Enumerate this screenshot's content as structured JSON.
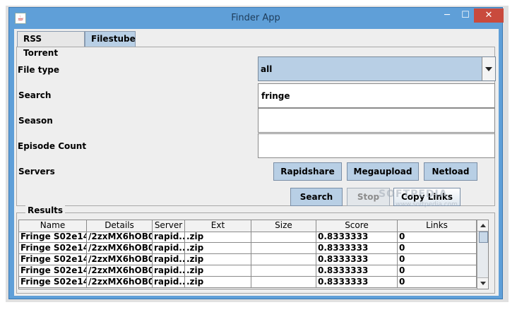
{
  "window": {
    "title": "Finder App",
    "min_glyph": "─",
    "max_glyph": "☐",
    "close_glyph": "✕",
    "app_icon_glyph": "☕"
  },
  "tabs": [
    {
      "label": "RSS Torrent"
    },
    {
      "label": "Filestube"
    }
  ],
  "form": {
    "file_type_label": "File type",
    "file_type_value": "all",
    "search_label": "Search",
    "search_value": "fringe",
    "season_label": "Season",
    "season_value": "",
    "episode_count_label": "Episode Count",
    "episode_count_value": "",
    "servers_label": "Servers"
  },
  "servers": {
    "rapidshare": "Rapidshare",
    "megaupload": "Megaupload",
    "netload": "Netload"
  },
  "actions": {
    "search": "Search",
    "stop": "Stop",
    "copy_links": "Copy Links"
  },
  "watermark": {
    "text": "SOFTPEDIA",
    "sub": "www.softpedia.com"
  },
  "results": {
    "title": "Results",
    "columns": [
      "Name",
      "Details",
      "Server",
      "Ext",
      "Size",
      "Score",
      "Links"
    ],
    "rows": [
      [
        "Fringe S02e14...",
        "/2zxMX6hOB0...",
        "rapid...",
        ".zip",
        "",
        "0.8333333",
        "0"
      ],
      [
        "Fringe S02e14...",
        "/2zxMX6hOB0...",
        "rapid...",
        ".zip",
        "",
        "0.8333333",
        "0"
      ],
      [
        "Fringe S02e14...",
        "/2zxMX6hOB0...",
        "rapid...",
        ".zip",
        "",
        "0.8333333",
        "0"
      ],
      [
        "Fringe S02e14...",
        "/2zxMX6hOB0...",
        "rapid...",
        ".zip",
        "",
        "0.8333333",
        "0"
      ],
      [
        "Fringe S02e14...",
        "/2zxMX6hOB0...",
        "rapid...",
        ".zip",
        "",
        "0.8333333",
        "0"
      ]
    ]
  },
  "colors": {
    "titlebar": "#5f9fd8",
    "selected": "#b8cfe5",
    "close": "#c94a3d"
  }
}
